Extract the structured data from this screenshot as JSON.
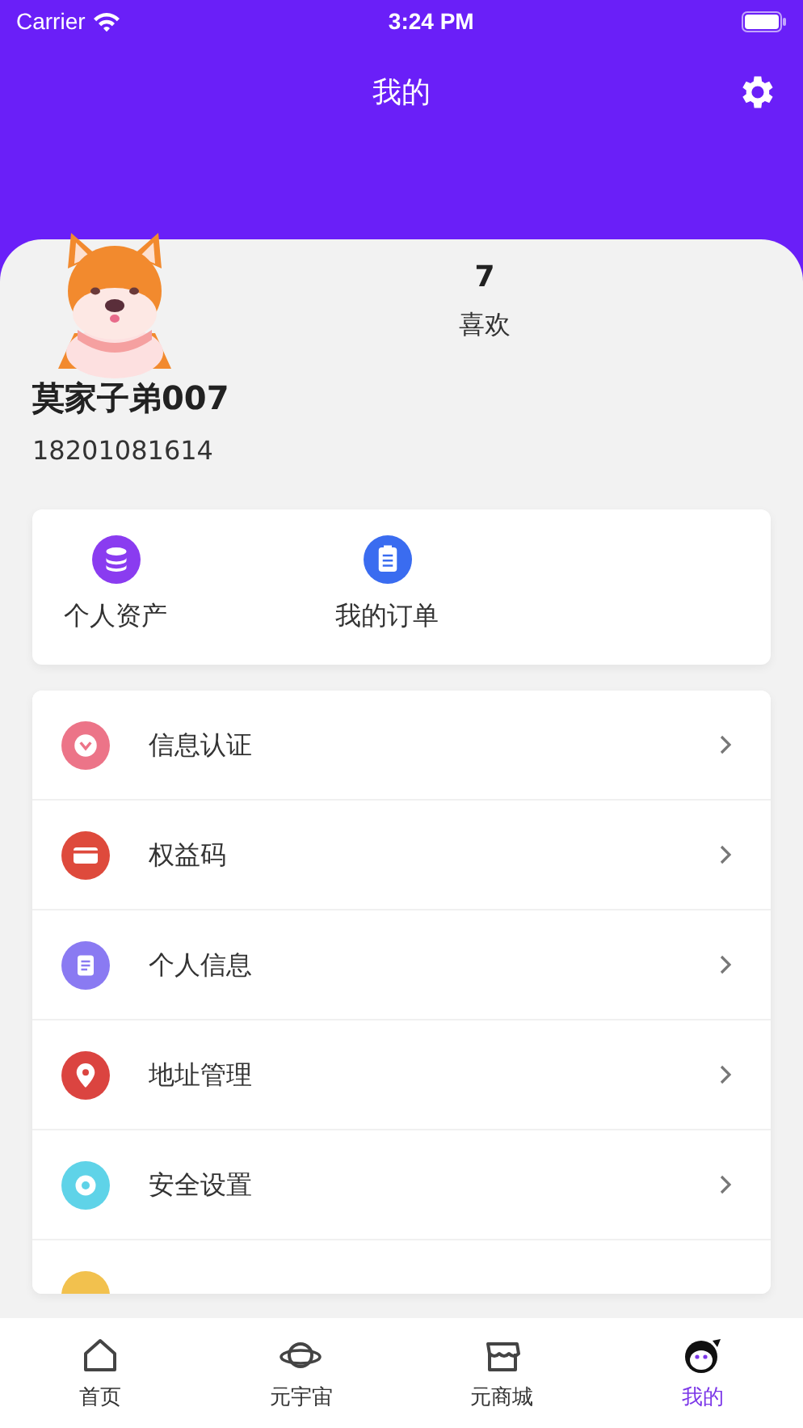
{
  "status_bar": {
    "carrier": "Carrier",
    "time": "3:24 PM"
  },
  "header": {
    "title": "我的"
  },
  "profile": {
    "likes_count": "7",
    "likes_label": "喜欢",
    "name": "莫家子弟007",
    "phone": "18201081614"
  },
  "shortcuts": [
    {
      "label": "个人资产",
      "kind": "coins",
      "color": "#8a3cf0"
    },
    {
      "label": "我的订单",
      "kind": "clipboard",
      "color": "#3a6cf0"
    }
  ],
  "menu": [
    {
      "label": "信息认证",
      "kind": "verify",
      "color": "#ec7488"
    },
    {
      "label": "权益码",
      "kind": "card",
      "color": "#de4a3c"
    },
    {
      "label": "个人信息",
      "kind": "doc",
      "color": "#8a7af2"
    },
    {
      "label": "地址管理",
      "kind": "pin",
      "color": "#db4440"
    },
    {
      "label": "安全设置",
      "kind": "gear",
      "color": "#5fd3e8"
    },
    {
      "kind": "partial",
      "color": "#f2c14e"
    }
  ],
  "tabs": [
    {
      "label": "首页",
      "kind": "home",
      "selected": false
    },
    {
      "label": "元宇宙",
      "kind": "planet",
      "selected": false
    },
    {
      "label": "元商城",
      "kind": "shop",
      "selected": false
    },
    {
      "label": "我的",
      "kind": "me",
      "selected": true
    }
  ]
}
